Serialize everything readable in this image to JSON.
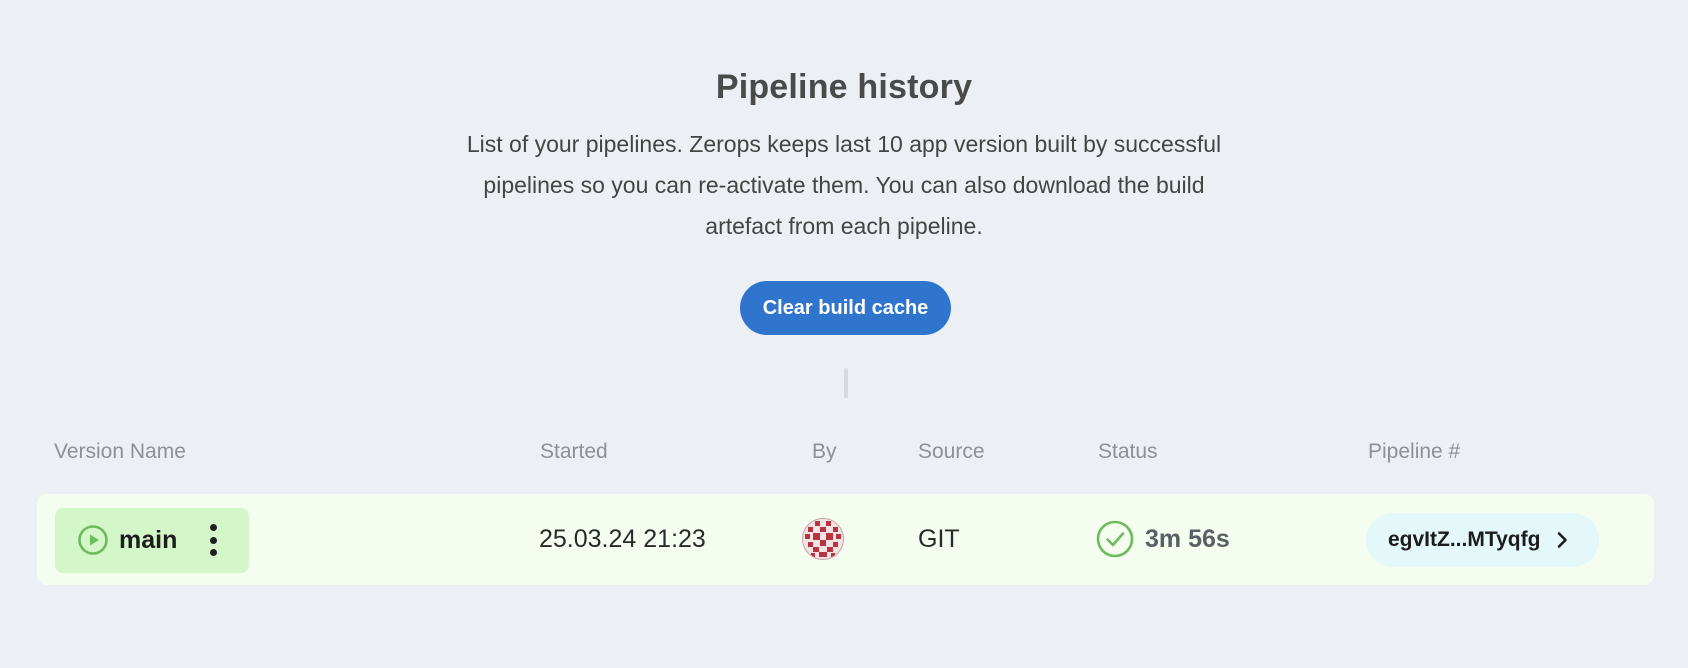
{
  "header": {
    "title": "Pipeline history",
    "description": "List of your pipelines. Zerops keeps last 10 app version built by successful pipelines so you can re-activate them. You can also download the build artefact from each pipeline.",
    "clear_cache_label": "Clear build cache"
  },
  "table": {
    "columns": [
      "Version Name",
      "Started",
      "By",
      "Source",
      "Status",
      "Pipeline #"
    ],
    "rows": [
      {
        "version_name": "main",
        "started": "25.03.24 21:23",
        "by_icon": "user-avatar-icon",
        "source": "GIT",
        "status_icon": "check-circle-icon",
        "status": "3m 56s",
        "pipeline_id": "egvItZ...MTyqfg"
      }
    ]
  },
  "colors": {
    "background": "#eceff3",
    "accent": "#2f74cd",
    "row_success_bg": "#f4fdf0",
    "version_chip_bg": "#d4f7c9",
    "success_green": "#6cbb5d",
    "pipeline_chip_bg": "#e4f8f9",
    "avatar_red": "#b8333e"
  }
}
